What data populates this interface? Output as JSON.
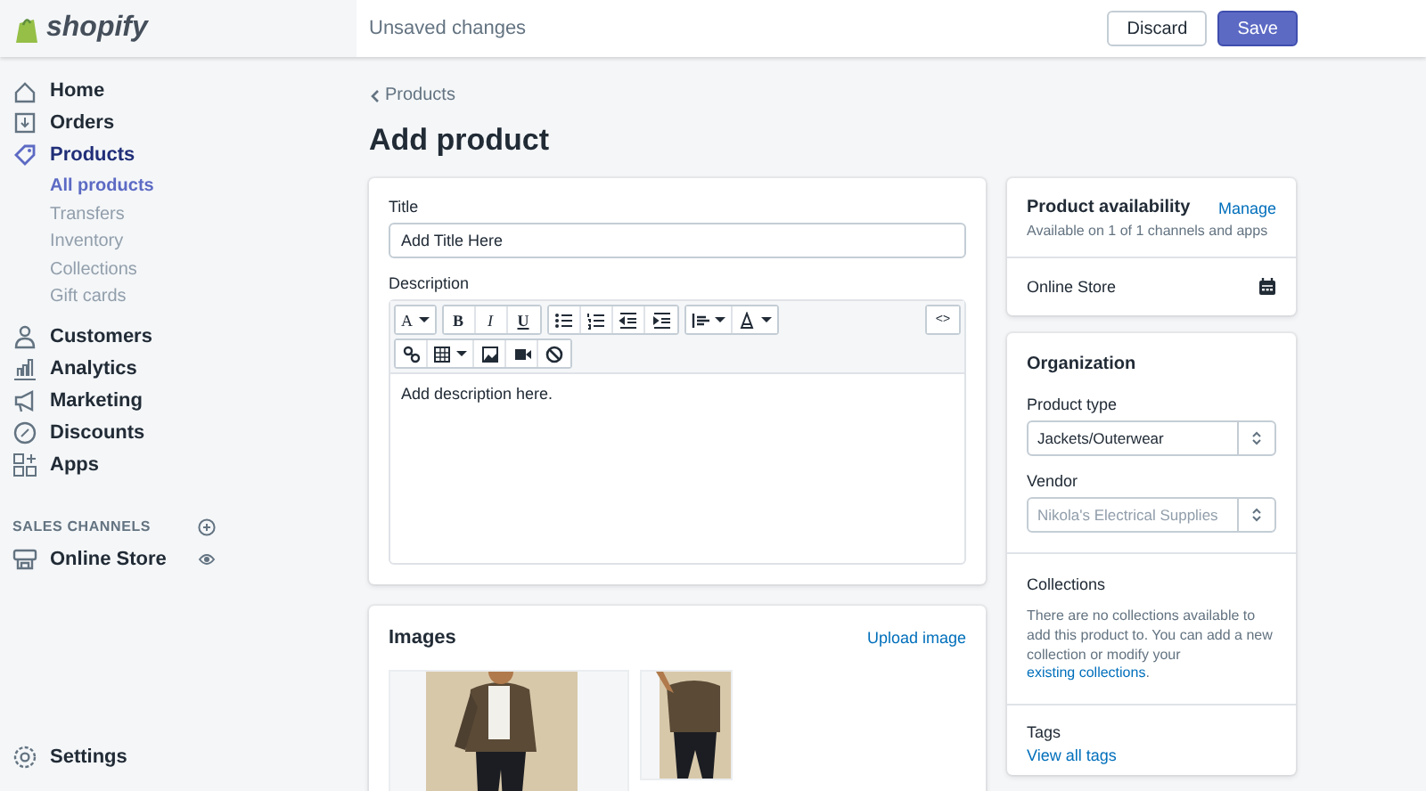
{
  "topbar": {
    "logo": "shopify",
    "message": "Unsaved changes",
    "buttons": [
      {
        "label": "Discard",
        "kind": "secondary"
      },
      {
        "label": "Save",
        "kind": "primary"
      }
    ]
  },
  "sidebar": {
    "items": [
      {
        "label": "Home",
        "selected": false
      },
      {
        "label": "Orders",
        "selected": false
      },
      {
        "label": "Products",
        "selected": true,
        "children": [
          {
            "label": "All products",
            "selected": true
          },
          {
            "label": "Transfers",
            "selected": false
          },
          {
            "label": "Inventory",
            "selected": false
          },
          {
            "label": "Collections",
            "selected": false
          },
          {
            "label": "Gift cards",
            "selected": false
          }
        ]
      },
      {
        "label": "Customers",
        "selected": false
      },
      {
        "label": "Analytics",
        "selected": false
      },
      {
        "label": "Marketing",
        "selected": false
      },
      {
        "label": "Discounts",
        "selected": false
      },
      {
        "label": "Apps",
        "selected": false
      }
    ],
    "section_title": "SALES CHANNELS",
    "channels": [
      {
        "label": "Online Store"
      }
    ],
    "settings": "Settings"
  },
  "breadcrumb": "Products",
  "page_title": "Add product",
  "product_card": {
    "title_label": "Title",
    "title_value": "Add Title Here",
    "description_label": "Description",
    "toolbar_labels": [
      "A",
      "B",
      "I",
      "U",
      "<>"
    ],
    "description_text": "Add description here."
  },
  "images_card": {
    "title": "Images",
    "action": "Upload image"
  },
  "availability_card": {
    "title": "Product availability",
    "action": "Manage",
    "subtitle": "Available on 1 of 1 channels and apps",
    "channels": [
      "Online Store"
    ]
  },
  "organization_card": {
    "title": "Organization",
    "fields": [
      {
        "label": "Product type",
        "value": "Jackets/Outerwear"
      },
      {
        "label": "Vendor",
        "placeholder": "Nikola's Electrical Supplies"
      }
    ],
    "collections_title": "Collections",
    "collections_text": "There are no collections available to add this product to. You can add a new collection or modify your",
    "collections_link": "existing collections",
    "collections_end": ".",
    "tags_title": "Tags",
    "tags_link": "View all tags"
  }
}
